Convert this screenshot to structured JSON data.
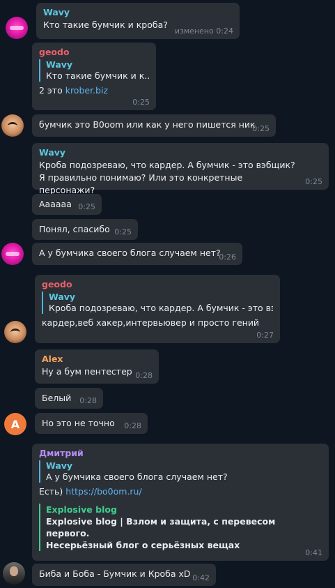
{
  "colors": {
    "background": "#0e1621",
    "bubble": "#2b3036",
    "wavy": "#5ec8e3",
    "geodo": "#e8606a",
    "alex": "#f2a35a",
    "dmitry": "#b68cf5",
    "link": "#5fb4f2",
    "preview": "#3fcf8e"
  },
  "messages": [
    {
      "name": "Wavy",
      "text": "Кто такие бумчик и кроба?",
      "time": "изменено 0:24"
    },
    {
      "name": "geodo",
      "quote_name": "Wavy",
      "quote_text": "Кто такие бумчик и к...",
      "text_prefix": "2 это ",
      "link": "krober.biz",
      "time": "0:25"
    },
    {
      "text": "бумчик это B0oom или как у него пишется ник",
      "time": "0:25"
    },
    {
      "name": "Wavy",
      "text": "Кроба подозреваю, что кардер. А бумчик - это вэбщик? Я правильно понимаю? Или это конкретные персонажи?",
      "time": "0:25"
    },
    {
      "text": "Аааааа",
      "time": "0:25"
    },
    {
      "text": "Понял, спасибо",
      "time": "0:25"
    },
    {
      "text": "А у бумчика своего блога случаем нет?",
      "time": "0:26"
    },
    {
      "name": "geodo",
      "quote_name": "Wavy",
      "quote_text": "Кроба подозреваю, что кардер. А бумчик - это вэ...",
      "text": "кардер,веб хакер,интервьювер и просто гений",
      "time": "0:27"
    },
    {
      "name": "Alex",
      "text": "Ну а бум пентестер",
      "time": "0:28"
    },
    {
      "text": "Белый",
      "time": "0:28"
    },
    {
      "text": "Но это не точно",
      "time": "0:28"
    },
    {
      "name": "Дмитрий",
      "quote_name": "Wavy",
      "quote_text": "А у бумчика своего блога случаем нет?",
      "text_prefix": "Есть) ",
      "link": "https://bo0om.ru/",
      "preview_site": "Explosive blog",
      "preview_title": "Explosive blog | Взлом и защита, с перевесом первого.",
      "preview_desc": "Несерьёзный блог о серьёзных вещах",
      "time": "0:41"
    },
    {
      "text": "Биба и Боба - Бумчик и Кроба xD",
      "time": "0:42"
    }
  ],
  "avatars": {
    "wavy": "wavy-avatar",
    "geodo": "geodo-avatar",
    "alex": "A",
    "dmitry": "dmitry-avatar"
  }
}
